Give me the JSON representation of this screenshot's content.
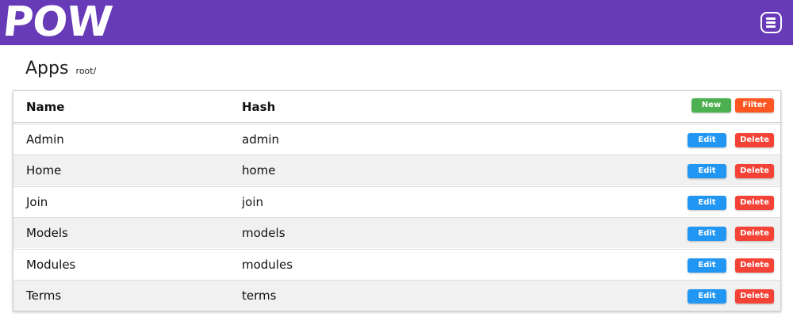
{
  "header": {
    "logo_text": "POW",
    "menu_icon": "menu-icon"
  },
  "page": {
    "title": "Apps",
    "breadcrumb": "root/"
  },
  "table": {
    "columns": {
      "name": "Name",
      "hash": "Hash"
    },
    "actions": {
      "new_label": "New",
      "filter_label": "Filter"
    },
    "row_actions": {
      "edit_label": "Edit",
      "delete_label": "Delete"
    },
    "rows": [
      {
        "name": "Admin",
        "hash": "admin"
      },
      {
        "name": "Home",
        "hash": "home"
      },
      {
        "name": "Join",
        "hash": "join"
      },
      {
        "name": "Models",
        "hash": "models"
      },
      {
        "name": "Modules",
        "hash": "modules"
      },
      {
        "name": "Terms",
        "hash": "terms"
      }
    ]
  },
  "colors": {
    "topbar": "#673ab7",
    "new": "#4caf50",
    "filter": "#ff5722",
    "edit": "#2196f3",
    "delete": "#f44336"
  }
}
